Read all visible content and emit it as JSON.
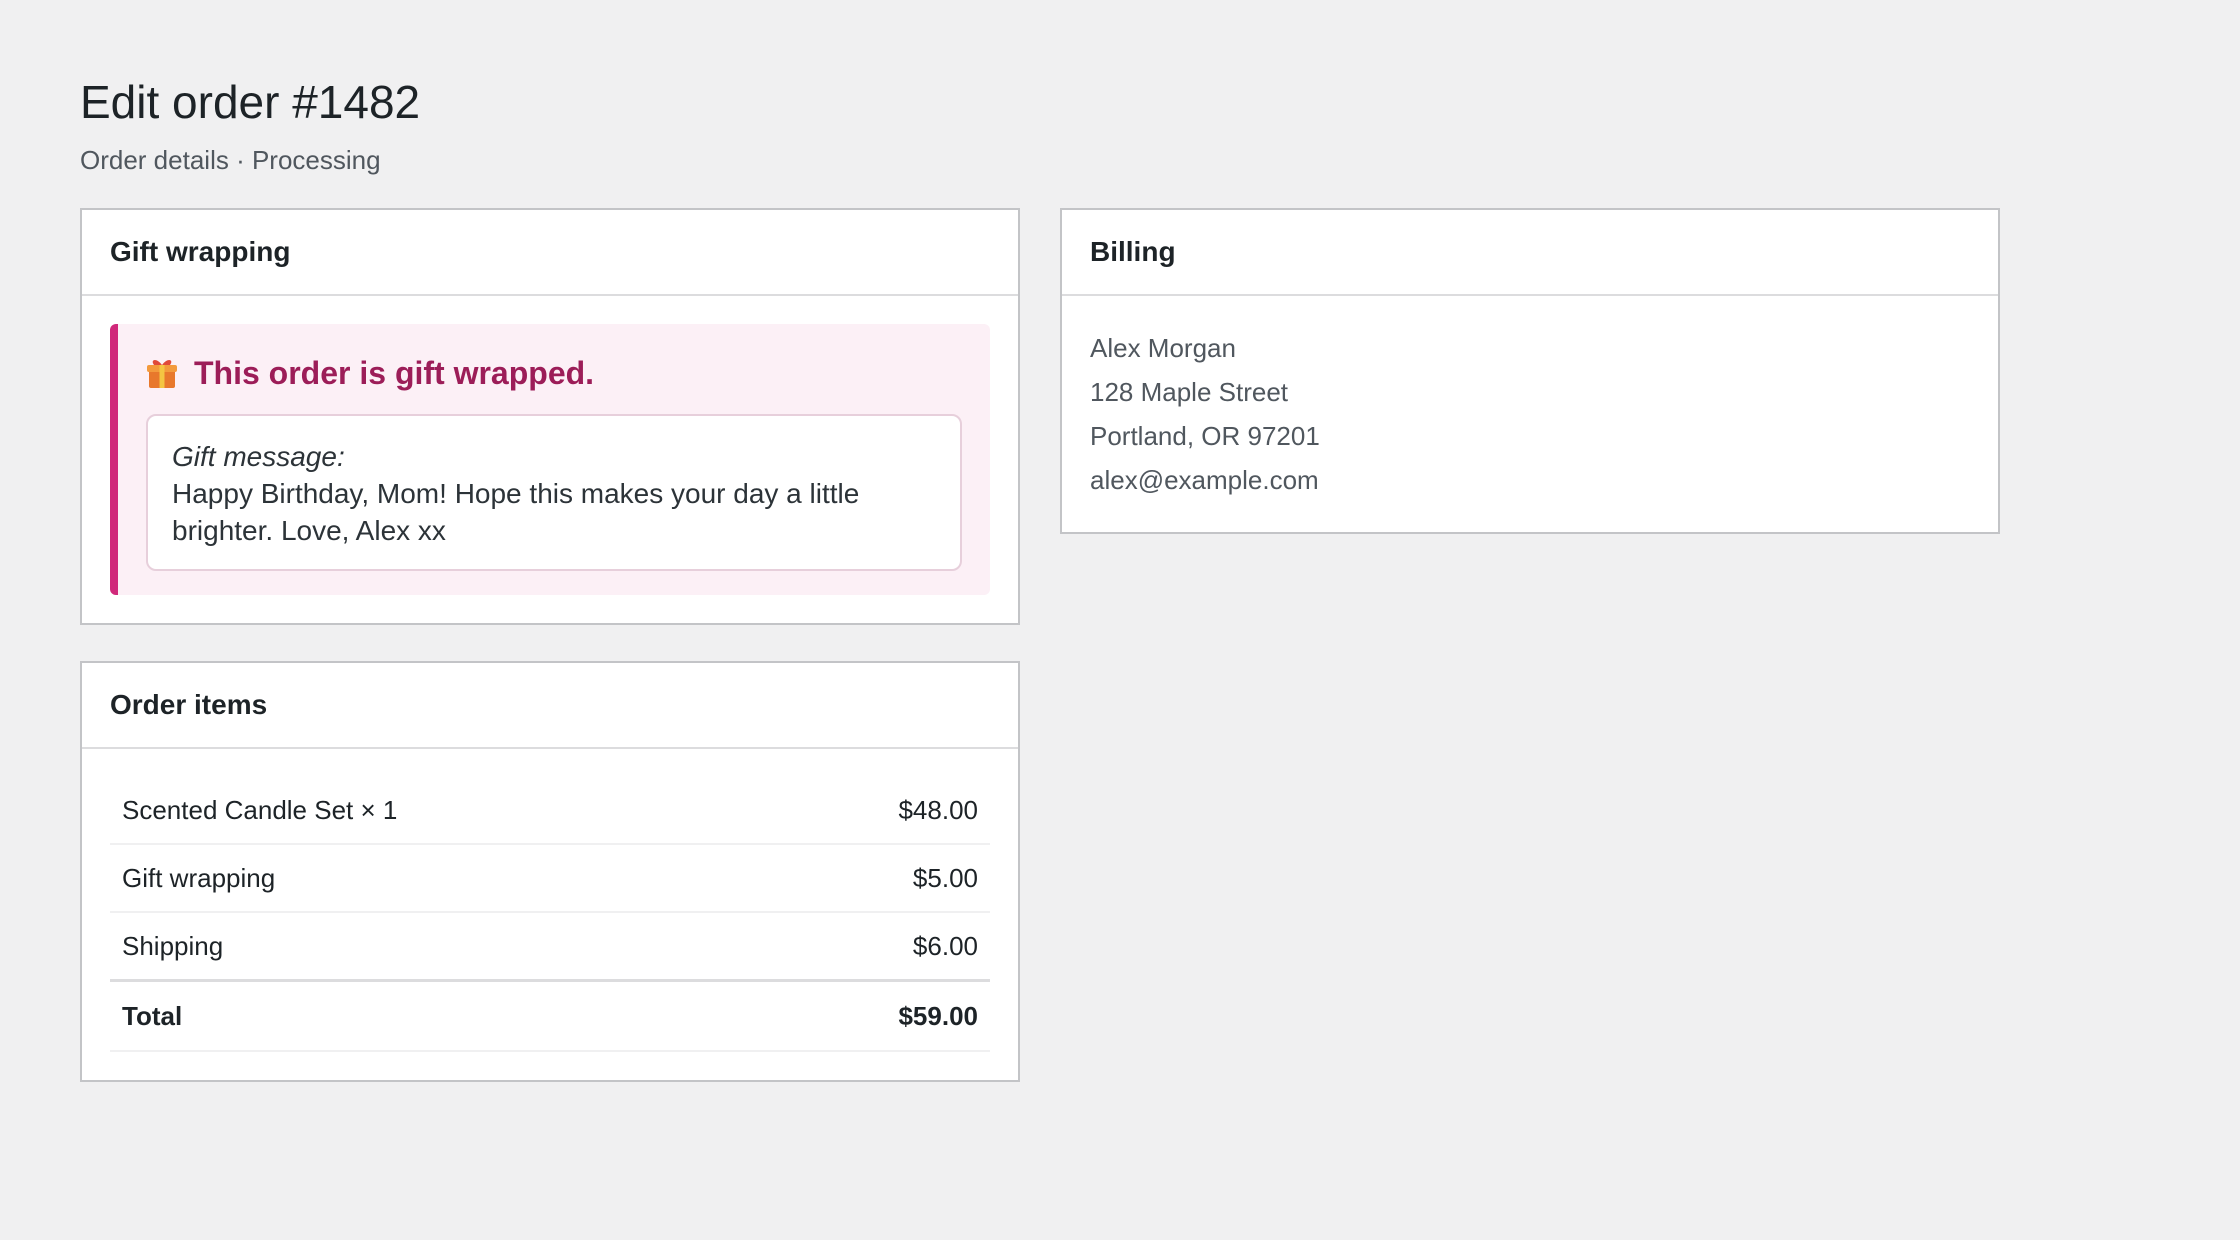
{
  "page": {
    "title": "Edit order #1482",
    "subtitle": "Order details · Processing"
  },
  "gift": {
    "header": "Gift wrapping",
    "title": "This order is gift wrapped.",
    "icon": "gift-icon",
    "message_label": "Gift message:",
    "message_text": "Happy Birthday, Mom! Hope this makes your day a little brighter. Love, Alex xx",
    "accent_color": "#d0287a"
  },
  "billing": {
    "header": "Billing",
    "name": "Alex Morgan",
    "street": "128 Maple Street",
    "city": "Portland, OR 97201",
    "email": "alex@example.com"
  },
  "items": {
    "header": "Order items",
    "rows": [
      {
        "label": "Scented Candle Set × 1",
        "amount": "$48.00"
      },
      {
        "label": "Gift wrapping",
        "amount": "$5.00"
      },
      {
        "label": "Shipping",
        "amount": "$6.00"
      }
    ],
    "total_label": "Total",
    "total_amount": "$59.00"
  }
}
